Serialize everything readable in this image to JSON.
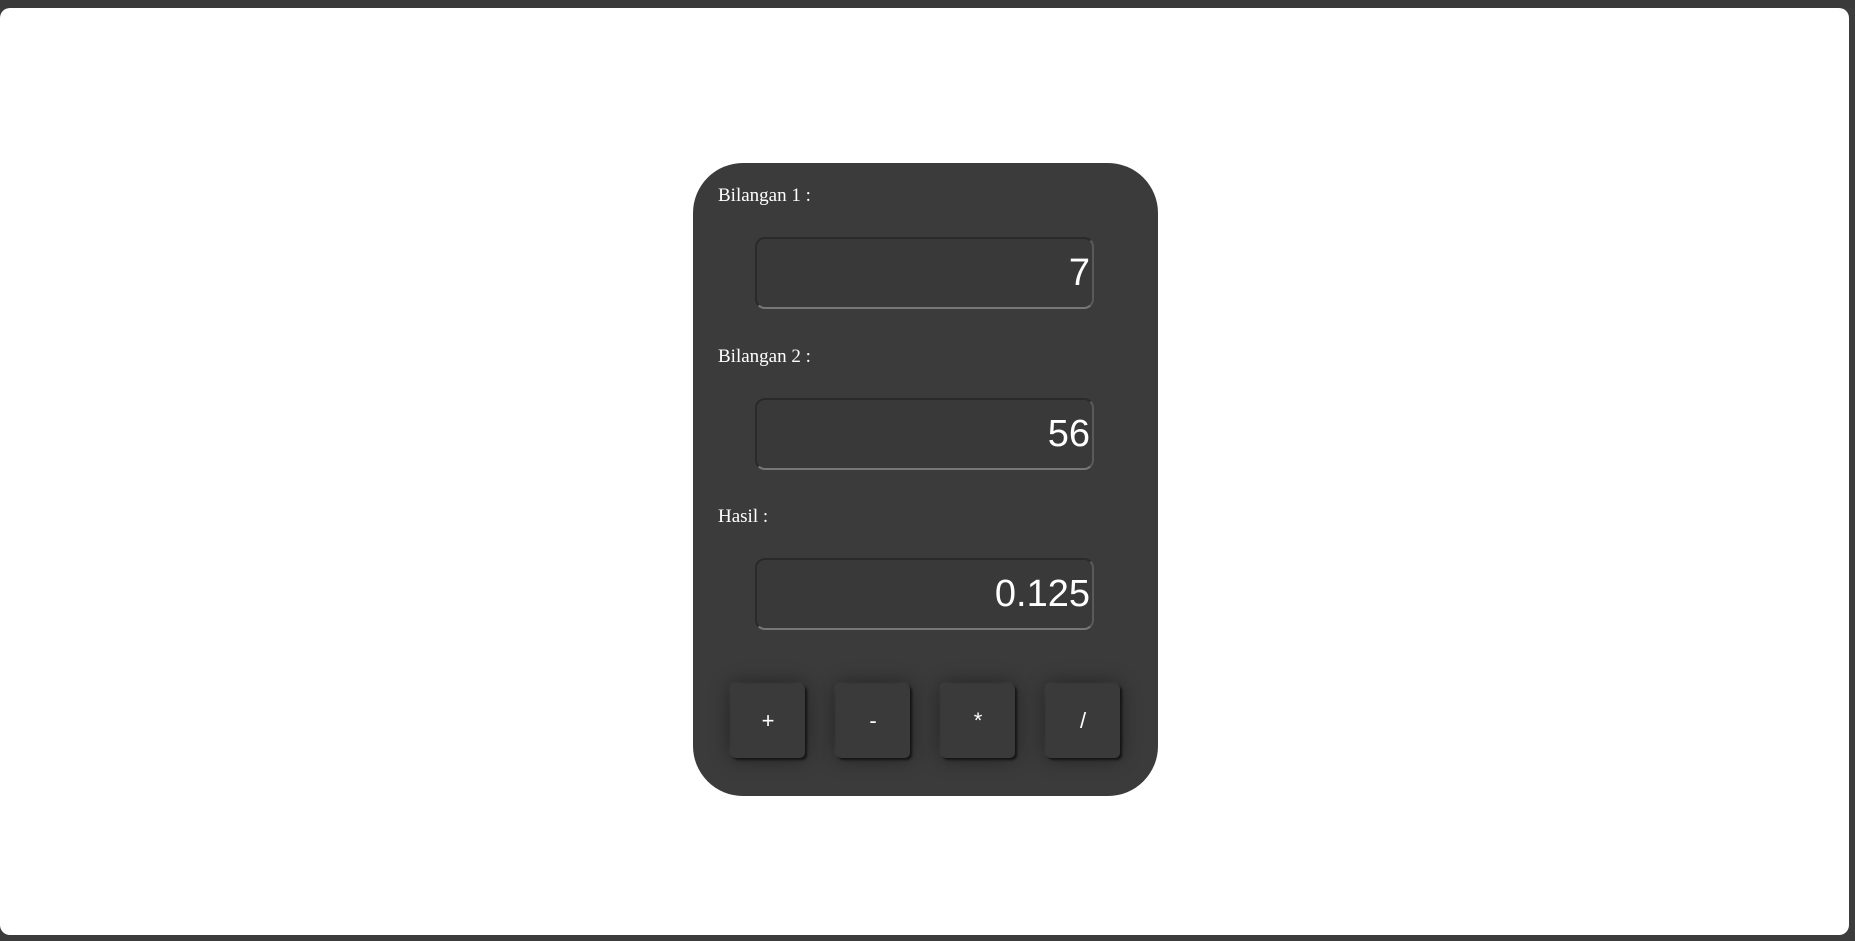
{
  "calculator": {
    "label_bilangan1": "Bilangan 1 :",
    "value_bilangan1": "7",
    "label_bilangan2": "Bilangan 2 :",
    "value_bilangan2": "56",
    "label_hasil": "Hasil :",
    "value_hasil": "0.125",
    "buttons": {
      "add": "+",
      "subtract": "-",
      "multiply": "*",
      "divide": "/"
    }
  },
  "colors": {
    "page_background": "#ffffff",
    "panel_background": "#3b3b3b",
    "text": "#ffffff",
    "window_frame": "#3c3c3c"
  }
}
